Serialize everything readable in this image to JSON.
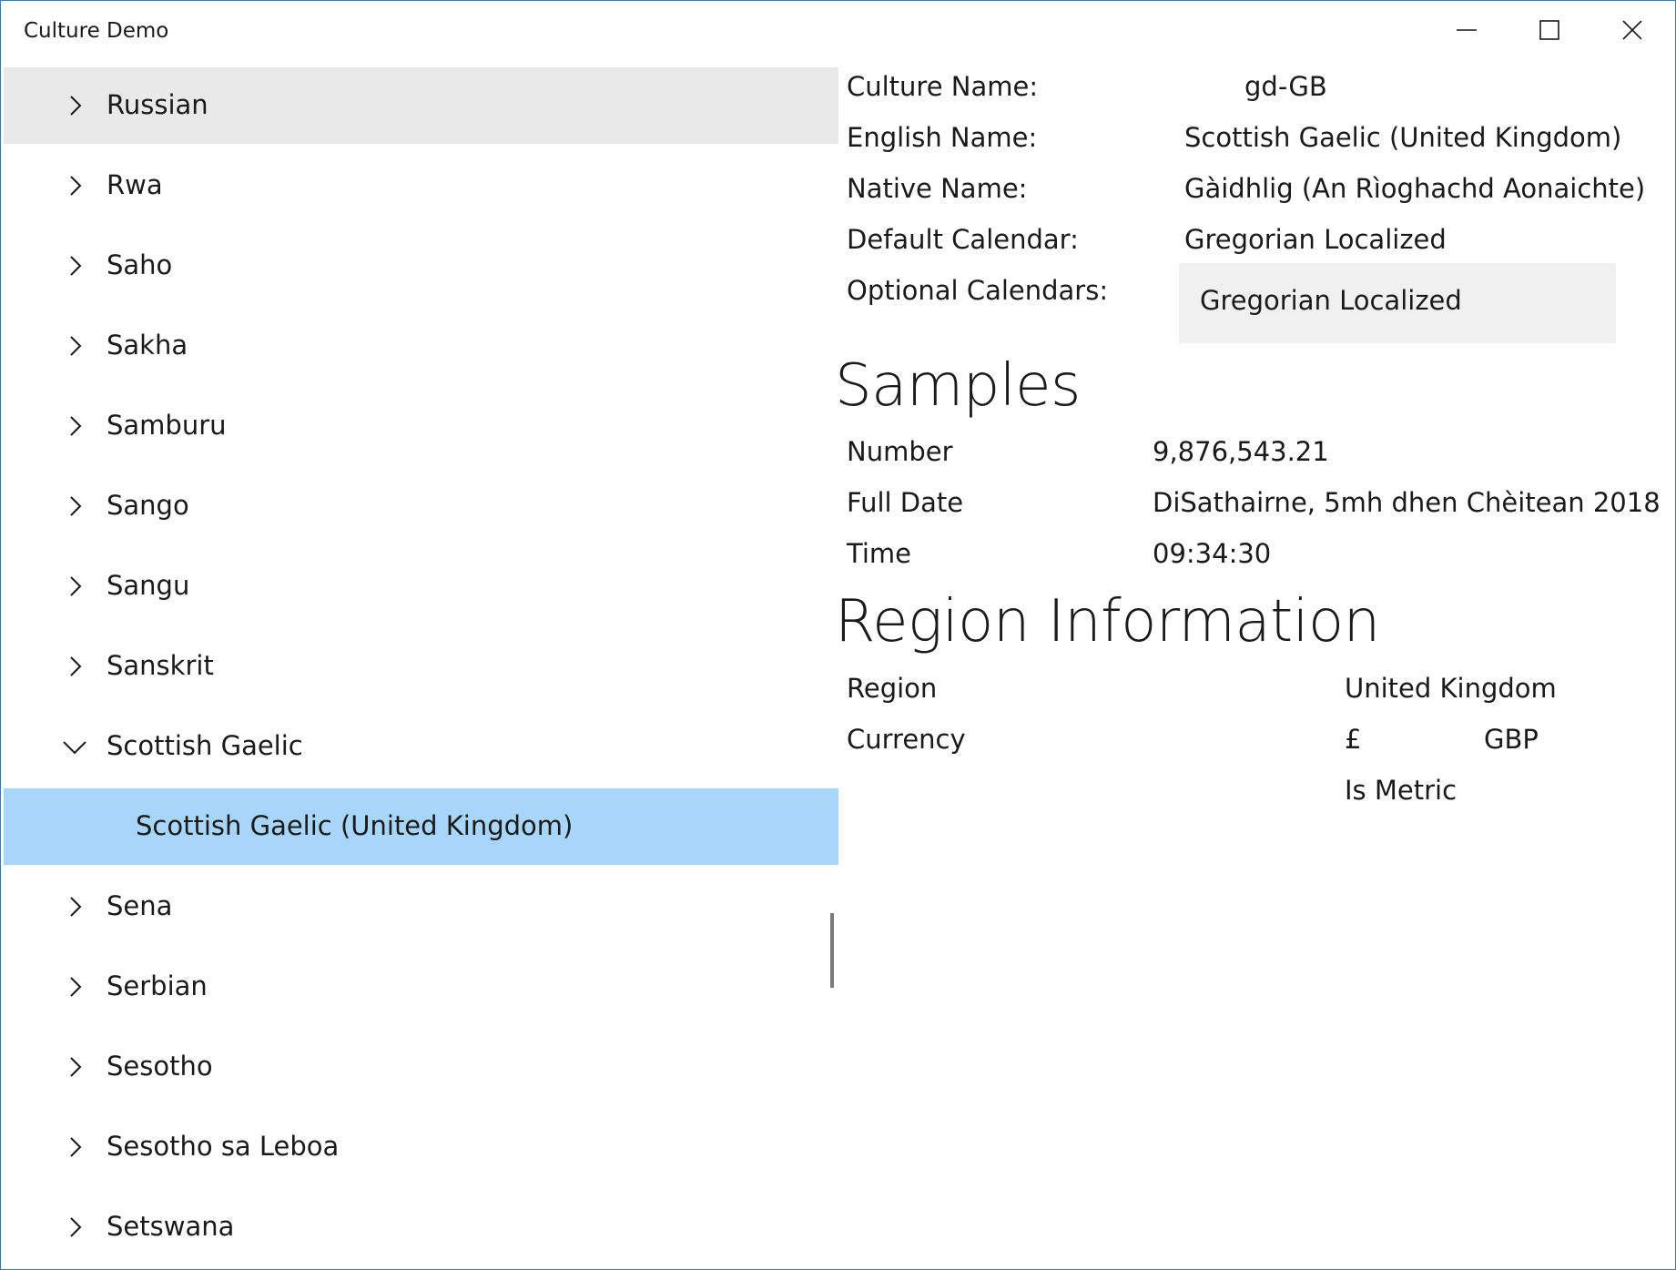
{
  "window": {
    "title": "Culture Demo",
    "controls": [
      "minimize",
      "maximize",
      "close"
    ]
  },
  "tree": {
    "items": [
      {
        "label": "Russian",
        "expanded": false,
        "state": "hover"
      },
      {
        "label": "Rwa",
        "expanded": false
      },
      {
        "label": "Saho",
        "expanded": false
      },
      {
        "label": "Sakha",
        "expanded": false
      },
      {
        "label": "Samburu",
        "expanded": false
      },
      {
        "label": "Sango",
        "expanded": false
      },
      {
        "label": "Sangu",
        "expanded": false
      },
      {
        "label": "Sanskrit",
        "expanded": false
      },
      {
        "label": "Scottish Gaelic",
        "expanded": true
      },
      {
        "label": "Scottish Gaelic (United Kingdom)",
        "child": true,
        "state": "selected"
      },
      {
        "label": "Sena",
        "expanded": false
      },
      {
        "label": "Serbian",
        "expanded": false
      },
      {
        "label": "Sesotho",
        "expanded": false
      },
      {
        "label": "Sesotho sa Leboa",
        "expanded": false
      },
      {
        "label": "Setswana",
        "expanded": false
      }
    ]
  },
  "culture": {
    "culture_name_label": "Culture Name:",
    "culture_name_value": "gd-GB",
    "english_name_label": "English Name:",
    "english_name_value": "Scottish Gaelic (United Kingdom)",
    "native_name_label": "Native Name:",
    "native_name_value": "Gàidhlig (An Rìoghachd Aonaichte)",
    "default_calendar_label": "Default Calendar:",
    "default_calendar_value": "Gregorian Localized",
    "optional_calendars_label": "Optional Calendars:",
    "optional_calendars": [
      "Gregorian Localized"
    ]
  },
  "samples": {
    "heading": "Samples",
    "number_label": "Number",
    "number_value": "9,876,543.21",
    "full_date_label": "Full Date",
    "full_date_value": "DiSathairne, 5mh dhen Chèitean 2018",
    "time_label": "Time",
    "time_value": "09:34:30"
  },
  "region": {
    "heading": "Region Information",
    "region_label": "Region",
    "region_value": "United Kingdom",
    "currency_label": "Currency",
    "currency_symbol": "£",
    "currency_code": "GBP",
    "metric_label": "Is Metric"
  },
  "colors": {
    "selected": "#a8d6fb",
    "hover": "#e9e9e9",
    "window_border": "#2b7bd3",
    "calendar_list_bg": "#f0f0f0"
  }
}
